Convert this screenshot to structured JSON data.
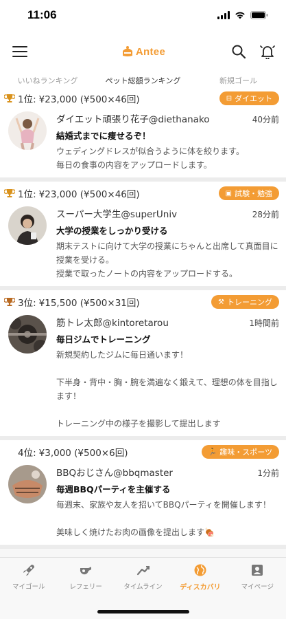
{
  "status": {
    "time": "11:06"
  },
  "header": {
    "logo_text": "Antee"
  },
  "tabs": [
    {
      "label": "いいねランキング",
      "active": false
    },
    {
      "label": "ペット総額ランキング",
      "active": true
    },
    {
      "label": "新規ゴール",
      "active": false
    }
  ],
  "posts": [
    {
      "rank": "1位:",
      "amount": "¥23,000 (¥500×46回)",
      "category": "ダイエット",
      "category_icon": "scale-icon",
      "user": "ダイエット頑張り花子@diethanako",
      "time": "40分前",
      "goal": "結婚式までに痩せるぞ！",
      "description": "ウェディングドレスが似合うように体を絞ります。\n毎日の食事の内容をアップロードします。"
    },
    {
      "rank": "1位:",
      "amount": "¥23,000 (¥500×46回)",
      "category": "試験・勉強",
      "category_icon": "book-icon",
      "user": "スーパー大学生@superUniv",
      "time": "28分前",
      "goal": "大学の授業をしっかり受ける",
      "description": "期末テストに向けて大学の授業にちゃんと出席して真面目に授業を受ける。\n授業で取ったノートの内容をアップロードする。"
    },
    {
      "rank": "3位:",
      "amount": "¥15,500 (¥500×31回)",
      "category": "トレーニング",
      "category_icon": "dumbbell-icon",
      "user": "筋トレ太郎@kintoretarou",
      "time": "1時間前",
      "goal": "毎日ジムでトレーニング",
      "description": "新規契約したジムに毎日通います！\n\n下半身・背中・胸・腕を満遍なく鍛えて、理想の体を目指します！\n\nトレーニング中の様子を撮影して提出します"
    },
    {
      "rank": "4位:",
      "amount": "¥3,000 (¥500×6回)",
      "category": "趣味・スポーツ",
      "category_icon": "running-icon",
      "user": "BBQおじさん@bbqmaster",
      "time": "1分前",
      "goal": "毎週BBQパーティを主催する",
      "description": "毎週末、家族や友人を招いてBBQパーティを開催します！\n\n美味しく焼けたお肉の画像を提出します🍖"
    }
  ],
  "bottom_nav": [
    {
      "label": "マイゴール",
      "icon": "rocket-icon",
      "active": false
    },
    {
      "label": "レフェリー",
      "icon": "whistle-icon",
      "active": false
    },
    {
      "label": "タイムライン",
      "icon": "trend-icon",
      "active": false
    },
    {
      "label": "ディスカバリ",
      "icon": "globe-icon",
      "active": true
    },
    {
      "label": "マイページ",
      "icon": "person-icon",
      "active": false
    }
  ],
  "colors": {
    "accent": "#f39c34",
    "gold": "#d9921c"
  }
}
